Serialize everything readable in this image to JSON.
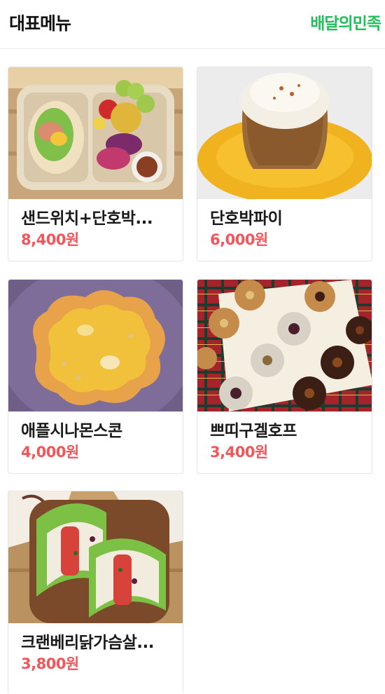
{
  "header": {
    "title": "대표메뉴",
    "brand_link": "배달의민족"
  },
  "colors": {
    "brand_green": "#21c05c",
    "price_red": "#f2555a"
  },
  "menu": [
    {
      "name": "샌드위치+단호박...",
      "price": "8,400원",
      "image": "sandwich-salad-lunchbox-image"
    },
    {
      "name": "단호박파이",
      "price": "6,000원",
      "image": "pumpkin-pie-image"
    },
    {
      "name": "애플시나몬스콘",
      "price": "4,000원",
      "image": "apple-cinnamon-scone-image"
    },
    {
      "name": "쁘띠구겔호프",
      "price": "3,400원",
      "image": "petit-gugelhopf-image"
    },
    {
      "name": "크랜베리닭가슴살...",
      "price": "3,800원",
      "image": "cranberry-chicken-sandwich-image"
    }
  ]
}
